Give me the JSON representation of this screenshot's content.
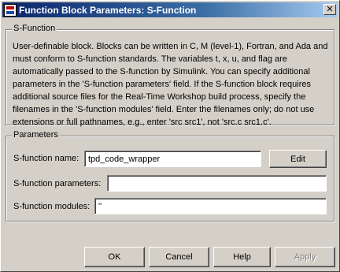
{
  "window": {
    "title": "Function Block Parameters: S-Function",
    "close_glyph": "✕"
  },
  "sfunction_group": {
    "title": "S-Function",
    "description_lines": [
      "User-definable block.  Blocks can be written in C, M (level-1), Fortran, and Ada and",
      "must conform to S-function standards.  The variables t, x, u, and flag are",
      "automatically passed to the S-function by Simulink.  You can specify additional",
      "parameters in the 'S-function parameters' field. If the S-function block requires",
      "additional source files for the Real-Time Workshop build process, specify the",
      "filenames in the 'S-function modules' field. Enter the filenames only; do not use",
      "extensions or full pathnames, e.g., enter 'src src1', not 'src.c src1.c'."
    ]
  },
  "parameters_group": {
    "title": "Parameters",
    "name_label": "S-function name:",
    "name_value": "tpd_code_wrapper",
    "edit_label": "Edit",
    "params_label": "S-function parameters:",
    "params_value": "",
    "modules_label": "S-function modules:",
    "modules_value": "''"
  },
  "buttons": {
    "ok": "OK",
    "cancel": "Cancel",
    "help": "Help",
    "apply": "Apply"
  },
  "colors": {
    "titlebar_start": "#0a246a",
    "titlebar_end": "#a6caf0",
    "dialog_bg": "#d4d0c8"
  },
  "icons": {
    "title_icon": "simulink-block-icon",
    "close_icon": "close-icon"
  }
}
